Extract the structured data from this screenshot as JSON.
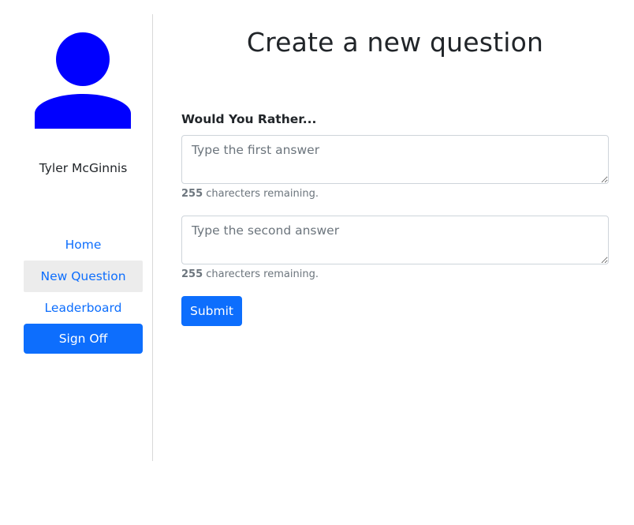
{
  "user": {
    "name": "Tyler McGinnis",
    "avatar_color": "#0000ff"
  },
  "nav": {
    "items": [
      {
        "label": "Home"
      },
      {
        "label": "New Question"
      },
      {
        "label": "Leaderboard"
      }
    ],
    "sign_off_label": "Sign Off"
  },
  "main": {
    "title": "Create a new question",
    "prompt": "Would You Rather...",
    "first_answer": {
      "value": "",
      "placeholder": "Type the first answer",
      "remaining_count": "255",
      "remaining_suffix": " charecters remaining."
    },
    "second_answer": {
      "value": "",
      "placeholder": "Type the second answer",
      "remaining_count": "255",
      "remaining_suffix": " charecters remaining."
    },
    "submit_label": "Submit"
  },
  "colors": {
    "primary": "#0d6efd",
    "active_nav_bg": "#ececec"
  }
}
